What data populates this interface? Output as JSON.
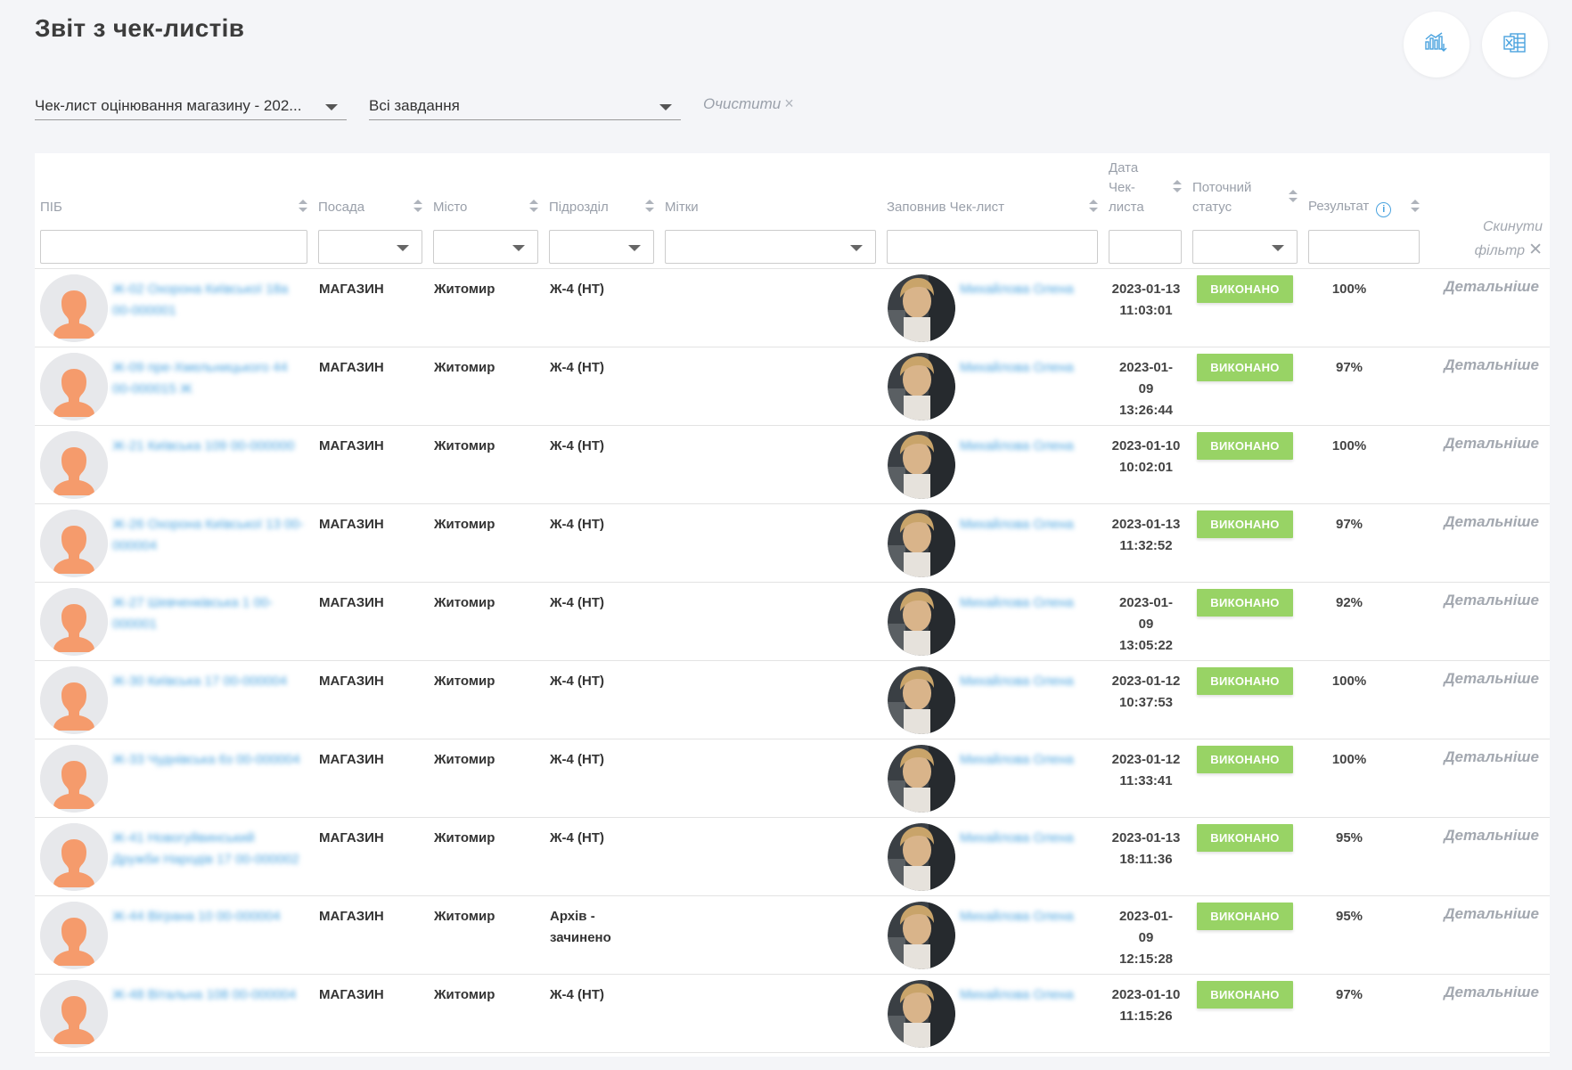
{
  "page": {
    "title": "Звіт з чек-листів"
  },
  "actions": [
    {
      "name": "chart-export-icon"
    },
    {
      "name": "excel-export-icon"
    }
  ],
  "filters": {
    "checklist": "Чек-лист оцінювання магазину - 202...",
    "tasks": "Всі завдання",
    "clear_label": "Очистити"
  },
  "table": {
    "columns": {
      "name": "ПІБ",
      "position": "Посада",
      "city": "Місто",
      "department": "Підрозділ",
      "tags": "Мітки",
      "filled_by": "Заповнив Чек-лист",
      "date_line1": "Дата",
      "date_line2": "Чек-",
      "date_line3": "листа",
      "status_line1": "Поточний",
      "status_line2": "статус",
      "result": "Результат"
    },
    "reset_filter_line1": "Скинути",
    "reset_filter_line2": "фільтр",
    "rows": [
      {
        "name": "Ж-02 Охорона Київської 18а 00-000001",
        "position": "МАГАЗИН",
        "city": "Житомир",
        "department": "Ж-4 (НТ)",
        "filled_by": "Михайлова Олена",
        "date_l1": "2023-01-13",
        "date_l2": "11:03:01",
        "date_l3": "",
        "status": "ВИКОНАНО",
        "result": "100%",
        "details": "Детальніше"
      },
      {
        "name": "Ж-09 пре-Хмельницького 44 00-000015 Ж",
        "position": "МАГАЗИН",
        "city": "Житомир",
        "department": "Ж-4 (НТ)",
        "filled_by": "Михайлова Олена",
        "date_l1": "2023-01-",
        "date_l2": "09",
        "date_l3": "13:26:44",
        "status": "ВИКОНАНО",
        "result": "97%",
        "details": "Детальніше"
      },
      {
        "name": "Ж-21 Київська 109 00-000000",
        "position": "МАГАЗИН",
        "city": "Житомир",
        "department": "Ж-4 (НТ)",
        "filled_by": "Михайлова Олена",
        "date_l1": "2023-01-10",
        "date_l2": "10:02:01",
        "date_l3": "",
        "status": "ВИКОНАНО",
        "result": "100%",
        "details": "Детальніше"
      },
      {
        "name": "Ж-26 Охорона Київської 13 00-000004",
        "position": "МАГАЗИН",
        "city": "Житомир",
        "department": "Ж-4 (НТ)",
        "filled_by": "Михайлова Олена",
        "date_l1": "2023-01-13",
        "date_l2": "11:32:52",
        "date_l3": "",
        "status": "ВИКОНАНО",
        "result": "97%",
        "details": "Детальніше"
      },
      {
        "name": "Ж-27 Шевченківська 1 00-000001",
        "position": "МАГАЗИН",
        "city": "Житомир",
        "department": "Ж-4 (НТ)",
        "filled_by": "Михайлова Олена",
        "date_l1": "2023-01-",
        "date_l2": "09",
        "date_l3": "13:05:22",
        "status": "ВИКОНАНО",
        "result": "92%",
        "details": "Детальніше"
      },
      {
        "name": "Ж-30 Київська 17 00-000004",
        "position": "МАГАЗИН",
        "city": "Житомир",
        "department": "Ж-4 (НТ)",
        "filled_by": "Михайлова Олена",
        "date_l1": "2023-01-12",
        "date_l2": "10:37:53",
        "date_l3": "",
        "status": "ВИКОНАНО",
        "result": "100%",
        "details": "Детальніше"
      },
      {
        "name": "Ж-33 Чуднівська 6з 00-000004",
        "position": "МАГАЗИН",
        "city": "Житомир",
        "department": "Ж-4 (НТ)",
        "filled_by": "Михайлова Олена",
        "date_l1": "2023-01-12",
        "date_l2": "11:33:41",
        "date_l3": "",
        "status": "ВИКОНАНО",
        "result": "100%",
        "details": "Детальніше"
      },
      {
        "name": "Ж-41 Новогуйвинський Дружби Народів 17 00-000002",
        "position": "МАГАЗИН",
        "city": "Житомир",
        "department": "Ж-4 (НТ)",
        "filled_by": "Михайлова Олена",
        "date_l1": "2023-01-13",
        "date_l2": "18:11:36",
        "date_l3": "",
        "status": "ВИКОНАНО",
        "result": "95%",
        "details": "Детальніше"
      },
      {
        "name": "Ж-44 Віграна 10 00-000004",
        "position": "МАГАЗИН",
        "city": "Житомир",
        "department": "Архів - зачинено",
        "filled_by": "Михайлова Олена",
        "date_l1": "2023-01-",
        "date_l2": "09",
        "date_l3": "12:15:28",
        "status": "ВИКОНАНО",
        "result": "95%",
        "details": "Детальніше"
      },
      {
        "name": "Ж-48 Вітальна 108 00-000004",
        "position": "МАГАЗИН",
        "city": "Житомир",
        "department": "Ж-4 (НТ)",
        "filled_by": "Михайлова Олена",
        "date_l1": "2023-01-10",
        "date_l2": "11:15:26",
        "date_l3": "",
        "status": "ВИКОНАНО",
        "result": "97%",
        "details": "Детальніше"
      }
    ]
  }
}
